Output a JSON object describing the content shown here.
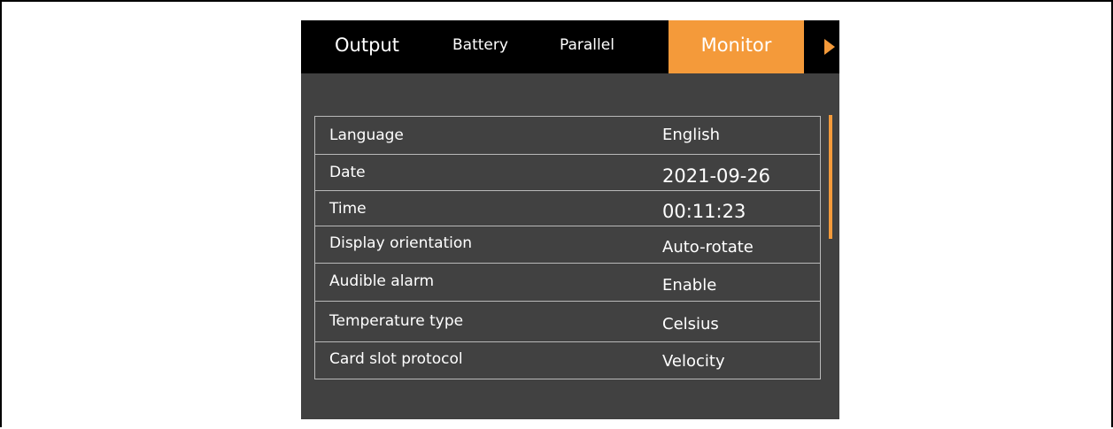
{
  "tabs": [
    {
      "label": "Output"
    },
    {
      "label": "Battery"
    },
    {
      "label": "Parallel"
    },
    {
      "label": "Monitor",
      "active": true
    }
  ],
  "accent_color": "#f49a3a",
  "screen_bg": "#414141",
  "next_icon": "play-arrow-icon",
  "settings": [
    {
      "label": "Language",
      "value": "English"
    },
    {
      "label": "Date",
      "value": "2021-09-26"
    },
    {
      "label": "Time",
      "value": "00:11:23"
    },
    {
      "label": "Display orientation",
      "value": "Auto-rotate"
    },
    {
      "label": "Audible alarm",
      "value": "Enable"
    },
    {
      "label": "Temperature type",
      "value": "Celsius"
    },
    {
      "label": "Card slot protocol",
      "value": "Velocity"
    }
  ]
}
